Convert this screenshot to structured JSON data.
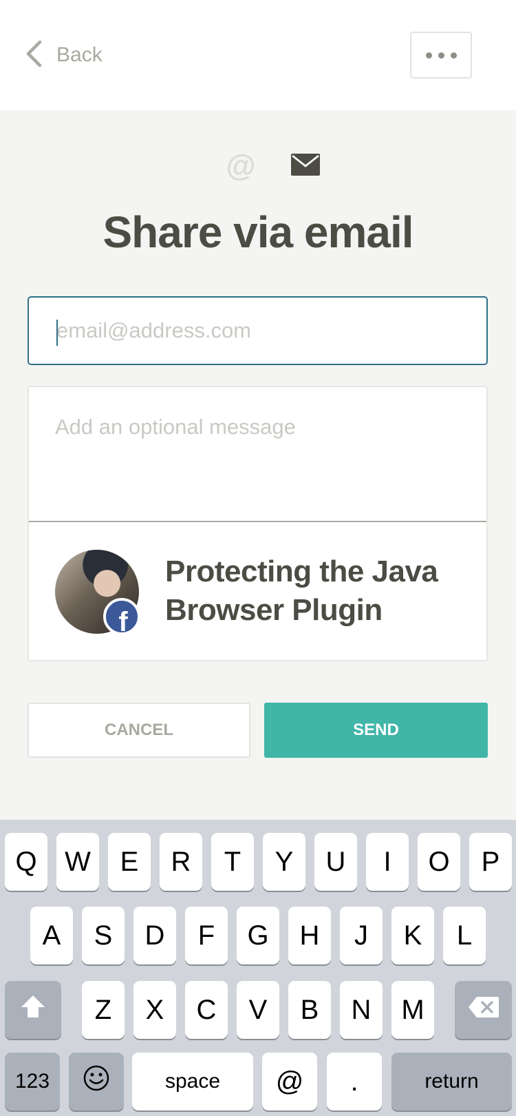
{
  "header": {
    "back_label": "Back"
  },
  "share": {
    "title": "Share via email",
    "email_placeholder": "email@address.com",
    "message_placeholder": "Add an optional message"
  },
  "article": {
    "title": "Protecting the Java Browser Plugin",
    "badge_letter": "f"
  },
  "actions": {
    "cancel_label": "CANCEL",
    "send_label": "SEND"
  },
  "keyboard": {
    "row1": [
      "Q",
      "W",
      "E",
      "R",
      "T",
      "Y",
      "U",
      "I",
      "O",
      "P"
    ],
    "row2": [
      "A",
      "S",
      "D",
      "F",
      "G",
      "H",
      "J",
      "K",
      "L"
    ],
    "row3": [
      "Z",
      "X",
      "C",
      "V",
      "B",
      "N",
      "M"
    ],
    "numbers_label": "123",
    "space_label": "space",
    "at_label": "@",
    "dot_label": ".",
    "return_label": "return"
  },
  "colors": {
    "accent_teal": "#40b5a8",
    "focus_border": "#2f6f86",
    "title_text": "#4c4c44",
    "facebook_blue": "#3b5998"
  }
}
